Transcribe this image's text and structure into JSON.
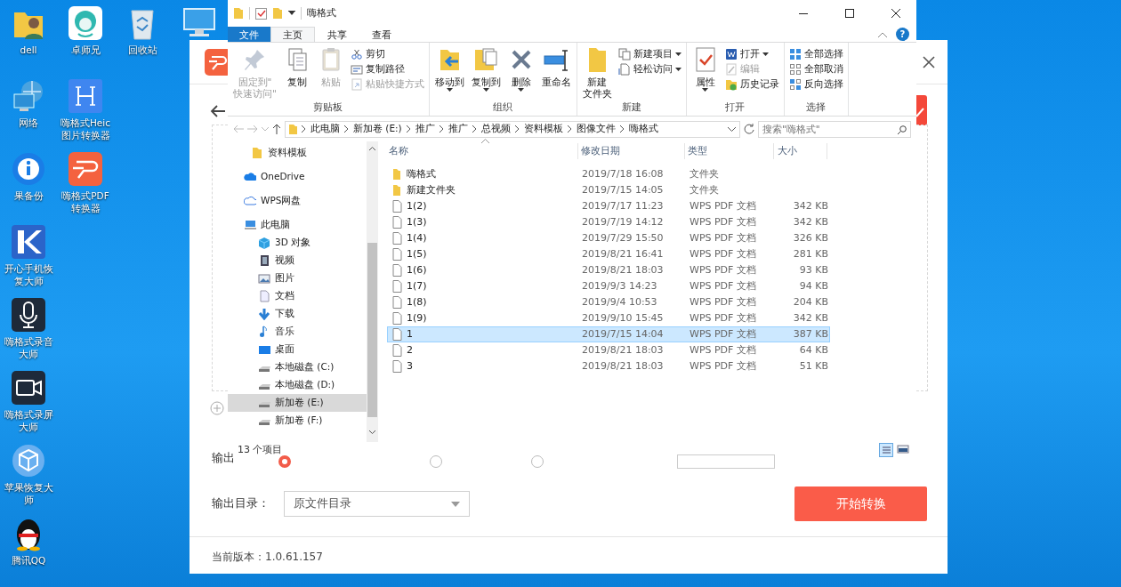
{
  "desktop": {
    "columns": [
      [
        {
          "label": "dell",
          "kind": "user-folder"
        },
        {
          "label": "网络",
          "kind": "network"
        },
        {
          "label": "果备份",
          "kind": "backup"
        },
        {
          "label": "开心手机恢复大师",
          "kind": "k"
        },
        {
          "label": "嗨格式录音大师",
          "kind": "mic"
        },
        {
          "label": "嗨格式录屏大师",
          "kind": "recorder"
        },
        {
          "label": "苹果恢复大师",
          "kind": "box"
        },
        {
          "label": "腾讯QQ",
          "kind": "penguin"
        }
      ],
      [
        {
          "label": "卓师兄",
          "kind": "monkey"
        },
        {
          "label": "嗨格式Heic图片转换器",
          "kind": "heic"
        },
        {
          "label": "嗨格式PDF转换器",
          "kind": "pdf"
        }
      ],
      [
        {
          "label": "回收站",
          "kind": "recycle"
        }
      ],
      [
        {
          "kind": "pc"
        }
      ]
    ]
  },
  "app": {
    "output_label": "输出",
    "output_options": [
      {
        "selected": true
      },
      {
        "selected": false
      },
      {
        "selected": false
      }
    ],
    "dir_label": "输出目录：",
    "dir_value": "原文件目录",
    "start_button": "开始转换",
    "version": "当前版本：1.0.61.157"
  },
  "explorer": {
    "title": "嗨格式",
    "help": "?",
    "tabs": [
      {
        "label": "文件",
        "kind": "file",
        "selected": false
      },
      {
        "label": "主页",
        "kind": "tab",
        "selected": true
      },
      {
        "label": "共享",
        "kind": "tab",
        "selected": false
      },
      {
        "label": "查看",
        "kind": "tab",
        "selected": false
      }
    ],
    "ribbon": [
      {
        "label": "剪贴板",
        "large": [
          {
            "lines": [
              "固定到\"",
              "快速访问\""
            ],
            "kind": "pin",
            "disabled": true,
            "dropdown": false
          },
          {
            "label": "复制",
            "kind": "copy",
            "disabled": false,
            "dropdown": false
          },
          {
            "label": "粘贴",
            "kind": "paste",
            "disabled": true,
            "dropdown": false
          }
        ],
        "small": [
          {
            "label": "剪切",
            "kind": "cut",
            "disabled": false,
            "dropdown": false
          },
          {
            "label": "复制路径",
            "kind": "copy-path",
            "disabled": false,
            "dropdown": false
          },
          {
            "label": "粘贴快捷方式",
            "kind": "paste-shortcut",
            "disabled": true,
            "dropdown": false
          }
        ]
      },
      {
        "label": "组织",
        "large": [
          {
            "label": "移动到",
            "kind": "move-to",
            "disabled": false,
            "dropdown": true
          },
          {
            "label": "复制到",
            "kind": "copy-to",
            "disabled": false,
            "dropdown": true
          },
          {
            "label": "删除",
            "kind": "delete",
            "disabled": false,
            "dropdown": true
          },
          {
            "label": "重命名",
            "kind": "rename",
            "disabled": false,
            "dropdown": false
          }
        ]
      },
      {
        "label": "新建",
        "large": [
          {
            "lines": [
              "新建",
              "文件夹"
            ],
            "kind": "new-folder",
            "disabled": false,
            "dropdown": false
          }
        ],
        "small": [
          {
            "label": "新建项目",
            "kind": "new-item",
            "disabled": false,
            "dropdown": true
          },
          {
            "label": "轻松访问",
            "kind": "easy-access",
            "disabled": false,
            "dropdown": true
          }
        ]
      },
      {
        "label": "打开",
        "large": [
          {
            "label": "属性",
            "kind": "properties",
            "disabled": false,
            "dropdown": true
          }
        ],
        "small": [
          {
            "label": "打开",
            "kind": "open",
            "disabled": false,
            "dropdown": true
          },
          {
            "label": "编辑",
            "kind": "edit",
            "disabled": true,
            "dropdown": false
          },
          {
            "label": "历史记录",
            "kind": "history",
            "disabled": false,
            "dropdown": false
          }
        ]
      },
      {
        "label": "选择",
        "small": [
          {
            "label": "全部选择",
            "kind": "select-all",
            "disabled": false,
            "dropdown": false
          },
          {
            "label": "全部取消",
            "kind": "select-none",
            "disabled": false,
            "dropdown": false
          },
          {
            "label": "反向选择",
            "kind": "invert",
            "disabled": false,
            "dropdown": false
          }
        ]
      }
    ],
    "path": [
      "此电脑",
      "新加卷 (E:)",
      "推广",
      "推广",
      "总视频",
      "资料模板",
      "图像文件",
      "嗨格式"
    ],
    "search": {
      "placeholder": "搜索\"嗨格式\""
    },
    "nav": [
      {
        "label": "资料模板",
        "kind": "folder",
        "selected": false
      },
      {
        "label": "OneDrive",
        "kind": "cloud",
        "selected": false
      },
      {
        "label": "WPS网盘",
        "kind": "cloud-outline",
        "selected": false
      },
      {
        "label": "此电脑",
        "kind": "pc",
        "selected": false,
        "children": [
          {
            "label": "3D 对象",
            "kind": "cube",
            "selected": false
          },
          {
            "label": "视频",
            "kind": "video",
            "selected": false
          },
          {
            "label": "图片",
            "kind": "picture",
            "selected": false
          },
          {
            "label": "文档",
            "kind": "document",
            "selected": false
          },
          {
            "label": "下载",
            "kind": "download",
            "selected": false
          },
          {
            "label": "音乐",
            "kind": "music",
            "selected": false
          },
          {
            "label": "桌面",
            "kind": "desktop",
            "selected": false
          },
          {
            "label": "本地磁盘 (C:)",
            "kind": "drive",
            "selected": false
          },
          {
            "label": "本地磁盘 (D:)",
            "kind": "drive",
            "selected": false
          },
          {
            "label": "新加卷 (E:)",
            "kind": "drive",
            "selected": true
          },
          {
            "label": "新加卷 (F:)",
            "kind": "drive",
            "selected": false
          }
        ]
      }
    ],
    "columns": [
      "名称",
      "修改日期",
      "类型",
      "大小"
    ],
    "files": [
      {
        "name": "嗨格式",
        "modified": "2019/7/18 16:08",
        "type": "文件夹",
        "kind": "folder",
        "selected": false
      },
      {
        "name": "新建文件夹",
        "modified": "2019/7/15 14:05",
        "type": "文件夹",
        "kind": "folder",
        "selected": false
      },
      {
        "name": "1(2)",
        "modified": "2019/7/17 11:23",
        "type": "WPS PDF 文档",
        "size": "342 KB",
        "kind": "file",
        "selected": false
      },
      {
        "name": "1(3)",
        "modified": "2019/7/19 14:12",
        "type": "WPS PDF 文档",
        "size": "342 KB",
        "kind": "file",
        "selected": false
      },
      {
        "name": "1(4)",
        "modified": "2019/7/29 15:50",
        "type": "WPS PDF 文档",
        "size": "326 KB",
        "kind": "file",
        "selected": false
      },
      {
        "name": "1(5)",
        "modified": "2019/8/21 16:41",
        "type": "WPS PDF 文档",
        "size": "281 KB",
        "kind": "file",
        "selected": false
      },
      {
        "name": "1(6)",
        "modified": "2019/8/21 18:03",
        "type": "WPS PDF 文档",
        "size": "93 KB",
        "kind": "file",
        "selected": false
      },
      {
        "name": "1(7)",
        "modified": "2019/9/3 14:23",
        "type": "WPS PDF 文档",
        "size": "94 KB",
        "kind": "file",
        "selected": false
      },
      {
        "name": "1(8)",
        "modified": "2019/9/4 10:53",
        "type": "WPS PDF 文档",
        "size": "204 KB",
        "kind": "file",
        "selected": false
      },
      {
        "name": "1(9)",
        "modified": "2019/9/10 15:45",
        "type": "WPS PDF 文档",
        "size": "342 KB",
        "kind": "file",
        "selected": false
      },
      {
        "name": "1",
        "modified": "2019/7/15 14:04",
        "type": "WPS PDF 文档",
        "size": "387 KB",
        "kind": "file",
        "selected": true
      },
      {
        "name": "2",
        "modified": "2019/8/21 18:03",
        "type": "WPS PDF 文档",
        "size": "64 KB",
        "kind": "file",
        "selected": false
      },
      {
        "name": "3",
        "modified": "2019/8/21 18:03",
        "type": "WPS PDF 文档",
        "size": "51 KB",
        "kind": "file",
        "selected": false
      }
    ],
    "status": "13 个项目"
  }
}
